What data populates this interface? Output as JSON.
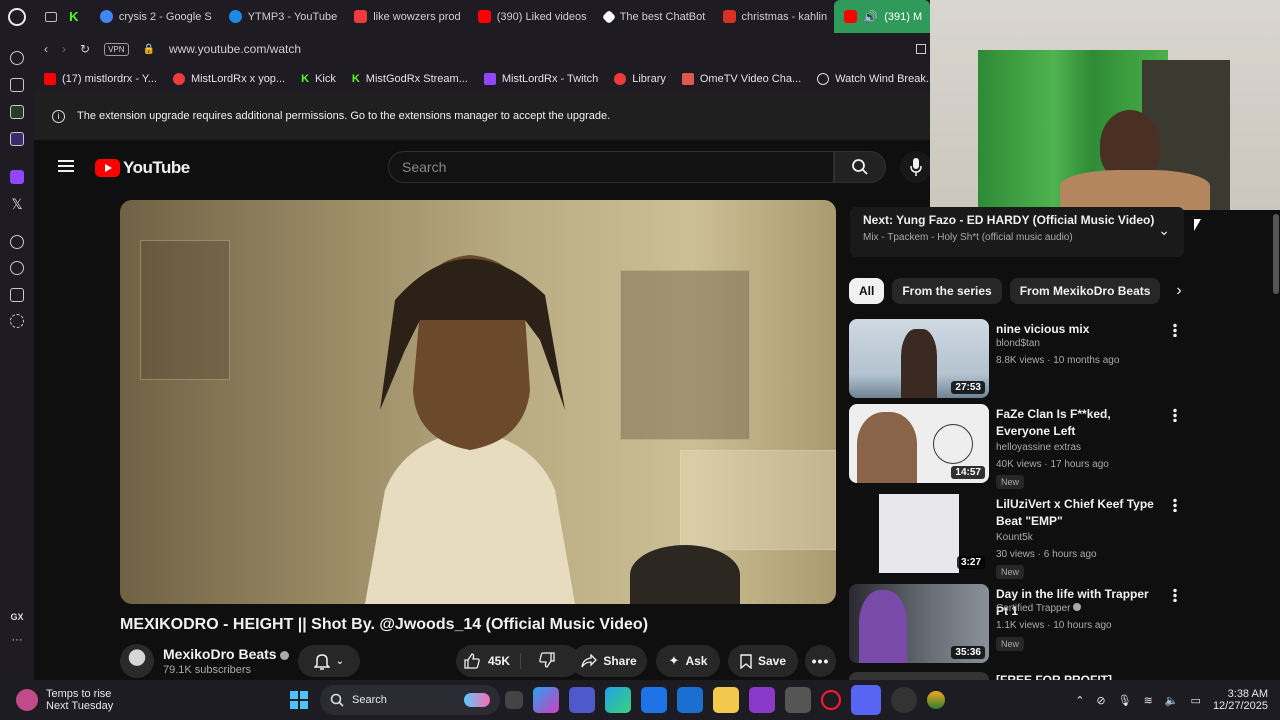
{
  "browser": {
    "tabs": [
      {
        "label": "crysis 2 - Google S",
        "color": "#4285f4"
      },
      {
        "label": "YTMP3 - YouTube",
        "color": "#1e88e5"
      },
      {
        "label": "like wowzers prod",
        "color": "#ef3b3b"
      },
      {
        "label": "(390) Liked videos",
        "color": "#ff0000"
      },
      {
        "label": "The best ChatBot",
        "color": "#ffffff"
      },
      {
        "label": "christmas - kahlin",
        "color": "#d93025"
      },
      {
        "label": "(391) M",
        "color": "#ff0000"
      }
    ],
    "url": "www.youtube.com/watch",
    "vpn_label": "VPN",
    "bookmarks": [
      {
        "label": "(17) mistlordrx - Y...",
        "color": "#ff0000"
      },
      {
        "label": "MistLordRx x yop...",
        "color": "#ef3b3b"
      },
      {
        "label": "Kick",
        "color": "#53fc18"
      },
      {
        "label": "MistGodRx Stream...",
        "color": "#53fc18"
      },
      {
        "label": "MistLordRx - Twitch",
        "color": "#9146ff"
      },
      {
        "label": "Library",
        "color": "#ef3b3b"
      },
      {
        "label": "OmeTV Video Cha...",
        "color": "#e0574f"
      },
      {
        "label": "Watch Wind Break...",
        "color": "#dddddd"
      }
    ],
    "notice": "The extension upgrade requires additional permissions. Go to the extensions manager to accept the upgrade."
  },
  "youtube": {
    "logo_text": "YouTube",
    "search_placeholder": "Search",
    "video_title": "MEXIKODRO - HEIGHT || Shot By. @Jwoods_14 (Official Music Video)",
    "channel_name": "MexikoDro Beats",
    "channel_subs": "79.1K subscribers",
    "likes": "45K",
    "share_label": "Share",
    "ask_label": "Ask",
    "save_label": "Save",
    "next": {
      "title": "Next: Yung Fazo - ED HARDY (Official Music Video)",
      "subtitle": "Mix - Tpackem - Holy Sh*t (official music audio)"
    },
    "chips": [
      "All",
      "From the series",
      "From MexikoDro Beats"
    ],
    "recommendations": [
      {
        "title": "nine vicious mix",
        "channel": "blond$tan",
        "meta": "8.8K views · 10 months ago",
        "duration": "27:53",
        "badge": ""
      },
      {
        "title": "FaZe Clan Is F**ked, Everyone Left",
        "channel": "helloyassine extras",
        "meta": "40K views · 17 hours ago",
        "duration": "14:57",
        "badge": "New"
      },
      {
        "title": "LilUziVert x Chief Keef Type Beat \"EMP\"",
        "channel": "Kount5k",
        "meta": "30 views · 6 hours ago",
        "duration": "3:27",
        "badge": "New"
      },
      {
        "title": "Day in the life with Trapper Pt 1",
        "channel": "Certified Trapper",
        "meta": "1.1K views · 10 hours ago",
        "duration": "35:36",
        "badge": "New"
      },
      {
        "title": "[FREE FOR PROFIT]",
        "channel": "",
        "meta": "",
        "duration": "",
        "badge": ""
      }
    ]
  },
  "taskbar": {
    "weather_title": "Temps to rise",
    "weather_sub": "Next Tuesday",
    "search_label": "Search",
    "time": "3:38 AM",
    "date": "12/27/2025"
  }
}
